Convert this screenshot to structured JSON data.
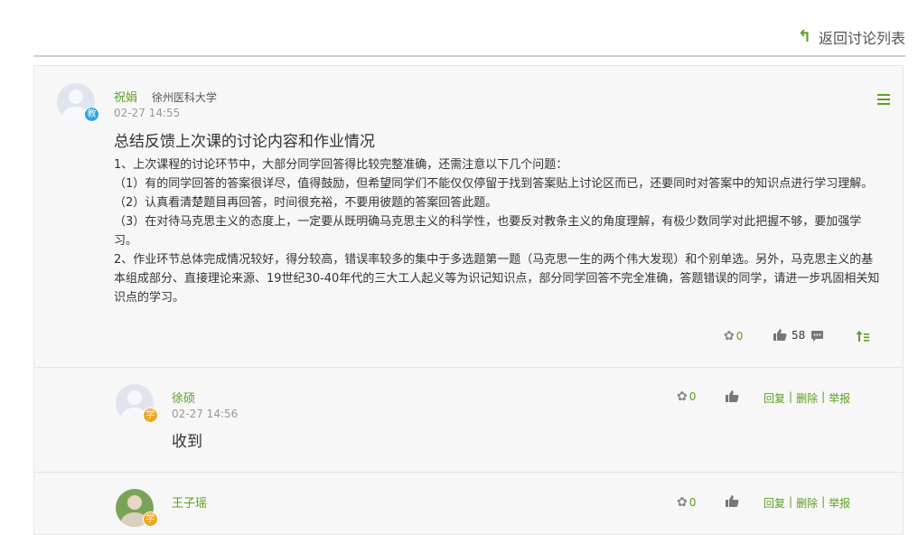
{
  "header": {
    "back_label": "返回讨论列表"
  },
  "post": {
    "author": "祝娟",
    "school": "徐州医科大学",
    "role_badge": "教",
    "time": "02-27 14:55",
    "title": "总结反馈上次课的讨论内容和作业情况",
    "paragraphs": [
      "1、上次课程的讨论环节中，大部分同学回答得比较完整准确，还需注意以下几个问题：",
      "（1）有的同学回答的答案很详尽，值得鼓励，但希望同学们不能仅仅停留于找到答案贴上讨论区而已，还要同时对答案中的知识点进行学习理解。",
      "（2）认真看清楚题目再回答，时间很充裕，不要用彼题的答案回答此题。",
      "（3）在对待马克思主义的态度上，一定要从既明确马克思主义的科学性，也要反对教条主义的角度理解，有极少数同学对此把握不够，要加强学习。",
      "2、作业环节总体完成情况较好，得分较高，错误率较多的集中于多选题第一题（马克思一生的两个伟大发现）和个别单选。另外，马克思主义的基本组成部分、直接理论来源、19世纪30-40年代的三大工人起义等为识记知识点，部分同学回答不完全准确，答题错误的同学，请进一步巩固相关知识点的学习。"
    ],
    "flower_count": "0",
    "like_count": "58"
  },
  "replies": [
    {
      "author": "徐硕",
      "role_badge": "学",
      "time": "02-27 14:56",
      "content": "收到",
      "flower_count": "0",
      "reply_label": "回复",
      "delete_label": "删除",
      "report_label": "举报"
    },
    {
      "author": "王子瑶",
      "role_badge": "学",
      "flower_count": "0",
      "reply_label": "回复",
      "delete_label": "删除",
      "report_label": "举报"
    }
  ],
  "colors": {
    "accent": "#5c9f20",
    "teacher_badge": "#2aa3e0",
    "student_badge": "#f3a51b"
  }
}
